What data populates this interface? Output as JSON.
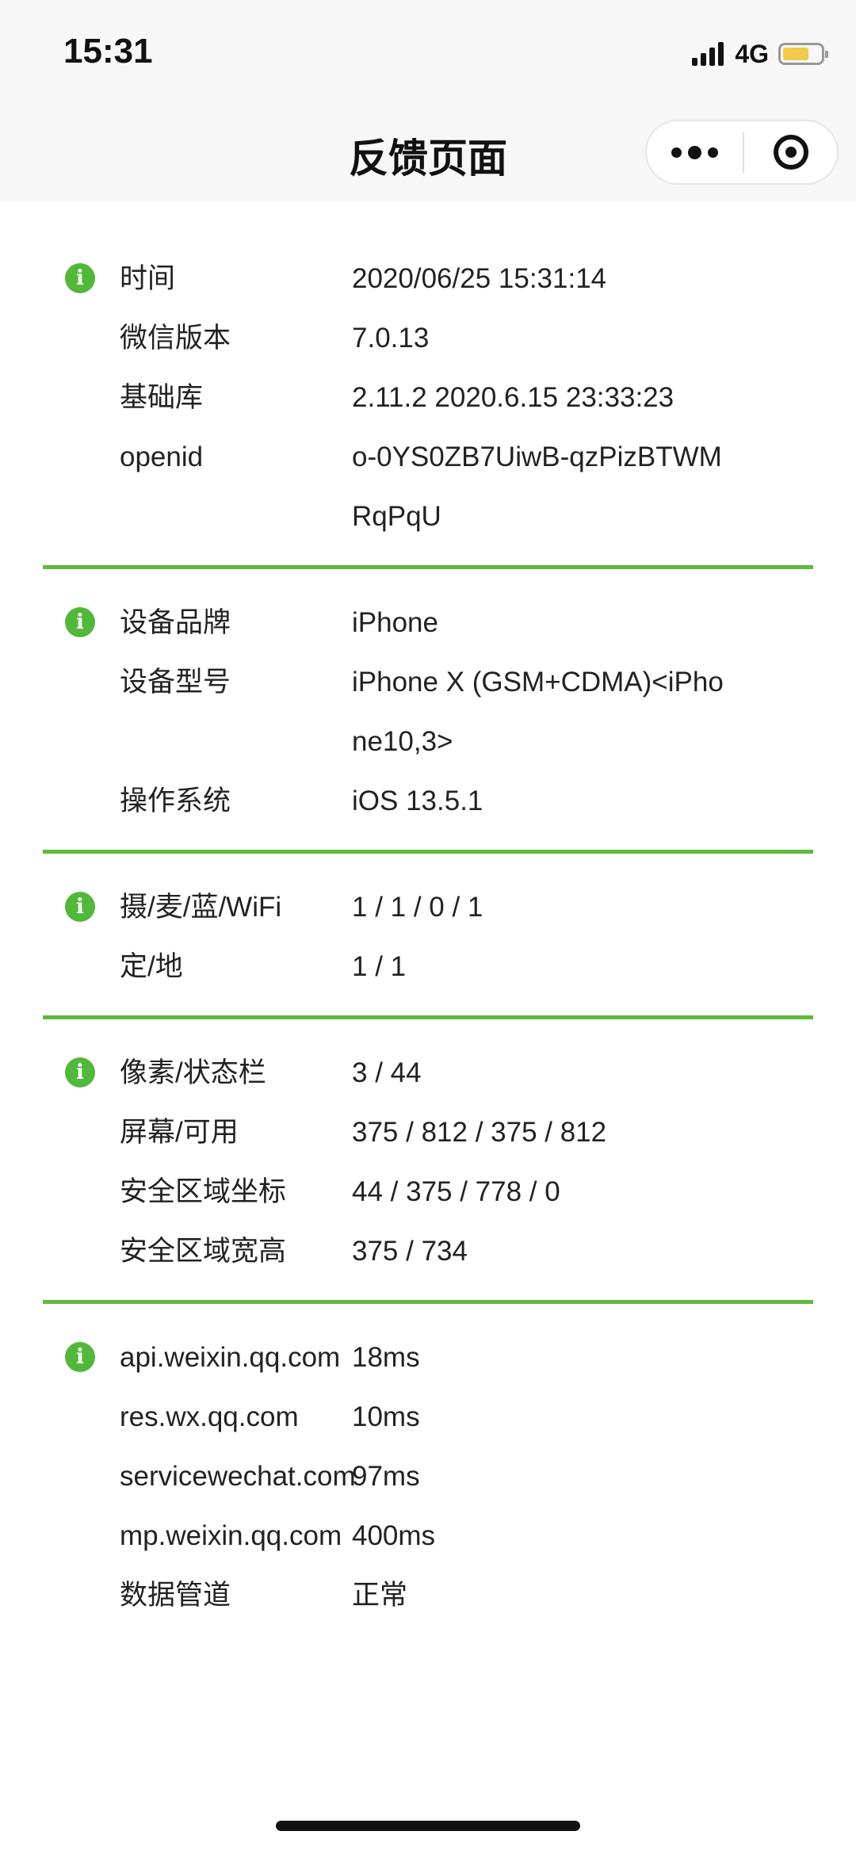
{
  "status": {
    "time": "15:31",
    "network": "4G",
    "battery_color": "#f2c94c"
  },
  "nav": {
    "title": "反馈页面",
    "more_icon": "more-dots-icon",
    "close_icon": "target-circle-icon"
  },
  "accent": "#5dba3b",
  "sections": [
    {
      "rows": [
        {
          "key": "时间",
          "value": "2020/06/25 15:31:14"
        },
        {
          "key": "微信版本",
          "value": "7.0.13"
        },
        {
          "key": "基础库",
          "value": "2.11.2 2020.6.15 23:33:23"
        },
        {
          "key": "openid",
          "value": "o-0YS0ZB7UiwB-qzPizBTWMRqPqU"
        }
      ]
    },
    {
      "rows": [
        {
          "key": "设备品牌",
          "value": "iPhone"
        },
        {
          "key": "设备型号",
          "value": "iPhone X (GSM+CDMA)<iPhone10,3>"
        },
        {
          "key": "操作系统",
          "value": "iOS 13.5.1"
        }
      ]
    },
    {
      "rows": [
        {
          "key": "摄/麦/蓝/WiFi",
          "value": "1 / 1 / 0 / 1"
        },
        {
          "key": "定/地",
          "value": "1 / 1"
        }
      ]
    },
    {
      "rows": [
        {
          "key": "像素/状态栏",
          "value": "3 / 44"
        },
        {
          "key": "屏幕/可用",
          "value": "375 / 812 / 375 / 812"
        },
        {
          "key": "安全区域坐标",
          "value": "44 / 375 / 778 / 0"
        },
        {
          "key": "安全区域宽高",
          "value": "375 / 734"
        }
      ]
    },
    {
      "rows": [
        {
          "key": "api.weixin.qq.com",
          "value": "18ms"
        },
        {
          "key": "res.wx.qq.com",
          "value": "10ms"
        },
        {
          "key": "servicewechat.com",
          "value": "97ms"
        },
        {
          "key": "mp.weixin.qq.com",
          "value": "400ms"
        },
        {
          "key": "数据管道",
          "value": "正常"
        }
      ]
    }
  ]
}
